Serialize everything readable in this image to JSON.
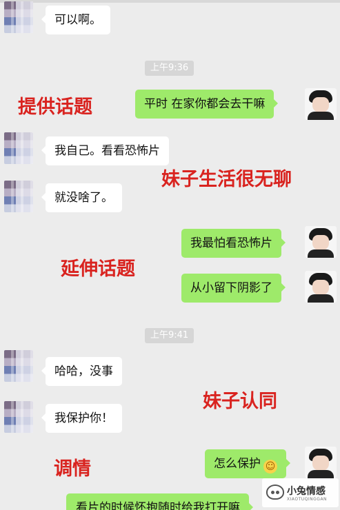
{
  "messages": [
    {
      "side": "left",
      "text": "可以啊。"
    },
    {
      "side": "right",
      "text": "平时 在家你都会去干嘛"
    },
    {
      "side": "left",
      "text": "我自己。看看恐怖片"
    },
    {
      "side": "left",
      "text": "就没啥了。"
    },
    {
      "side": "right",
      "text": "我最怕看恐怖片"
    },
    {
      "side": "right",
      "text": "从小留下阴影了"
    },
    {
      "side": "left",
      "text": "哈哈，没事"
    },
    {
      "side": "left",
      "text": "我保护你！"
    },
    {
      "side": "right",
      "text": "怎么保护"
    },
    {
      "side": "right",
      "text": "看片的时候怀抱随时给我打开嘛"
    }
  ],
  "timestamps": [
    "上午9:36",
    "上午9:41"
  ],
  "annotations": [
    "提供话题",
    "妹子生活很无聊",
    "延伸话题",
    "妹子认同",
    "调情"
  ],
  "watermark": {
    "title": "小兔情感",
    "subtitle": "XIAOTUQINGGAN"
  },
  "colors": {
    "bubble_right": "#9eea6a",
    "bubble_left": "#ffffff",
    "annotation": "#d9231f",
    "background": "#ececec"
  },
  "icons": {
    "emoji": "smile-emoji-icon"
  }
}
